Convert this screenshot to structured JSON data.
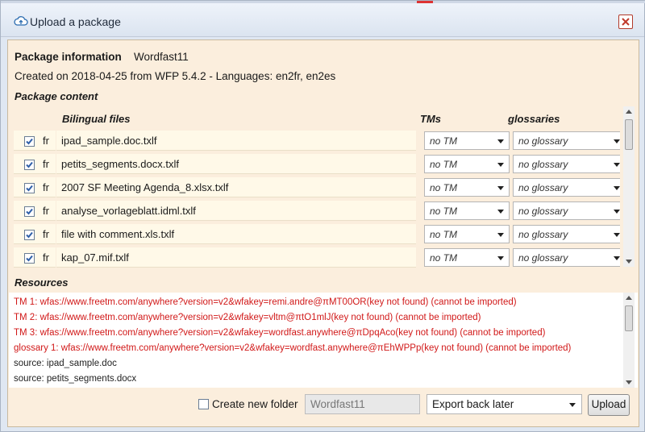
{
  "window": {
    "title": "Upload a package"
  },
  "package": {
    "label": "Package information",
    "name": "Wordfast11",
    "created": "Created on 2018-04-25 from WFP 5.4.2 - Languages: en2fr, en2es"
  },
  "content": {
    "section_label": "Package content",
    "columns": {
      "files": "Bilingual files",
      "tms": "TMs",
      "glossaries": "glossaries"
    },
    "rows": [
      {
        "checked": true,
        "lang": "fr",
        "file": "ipad_sample.doc.txlf",
        "tm": "no TM",
        "glossary": "no glossary"
      },
      {
        "checked": true,
        "lang": "fr",
        "file": "petits_segments.docx.txlf",
        "tm": "no TM",
        "glossary": "no glossary"
      },
      {
        "checked": true,
        "lang": "fr",
        "file": "2007 SF Meeting Agenda_8.xlsx.txlf",
        "tm": "no TM",
        "glossary": "no glossary"
      },
      {
        "checked": true,
        "lang": "fr",
        "file": "analyse_vorlageblatt.idml.txlf",
        "tm": "no TM",
        "glossary": "no glossary"
      },
      {
        "checked": true,
        "lang": "fr",
        "file": "file with comment.xls.txlf",
        "tm": "no TM",
        "glossary": "no glossary"
      },
      {
        "checked": true,
        "lang": "fr",
        "file": "kap_07.mif.txlf",
        "tm": "no TM",
        "glossary": "no glossary"
      }
    ]
  },
  "resources": {
    "section_label": "Resources",
    "lines": [
      {
        "kind": "error",
        "text": "TM 1: wfas://www.freetm.com/anywhere?version=v2&wfakey=remi.andre@πMT00OR(key not found) (cannot be imported)"
      },
      {
        "kind": "error",
        "text": "TM 2: wfas://www.freetm.com/anywhere?version=v2&wfakey=vltm@πtO1mlJ(key not found) (cannot be imported)"
      },
      {
        "kind": "error",
        "text": "TM 3: wfas://www.freetm.com/anywhere?version=v2&wfakey=wordfast.anywhere@πDpqAco(key not found) (cannot be imported)"
      },
      {
        "kind": "error",
        "text": "glossary 1: wfas://www.freetm.com/anywhere?version=v2&wfakey=wordfast.anywhere@πEhWPPp(key not found) (cannot be imported)"
      },
      {
        "kind": "source",
        "text": "source: ipad_sample.doc"
      },
      {
        "kind": "source",
        "text": "source: petits_segments.docx"
      }
    ]
  },
  "footer": {
    "create_folder_label": "Create new folder",
    "create_folder_checked": false,
    "folder_name": "Wordfast11",
    "export_option": "Export back later",
    "upload_label": "Upload"
  },
  "colors": {
    "panel_bg": "#fbeedd",
    "error_text": "#d11818",
    "checkbox_check": "#2f5fa8"
  }
}
